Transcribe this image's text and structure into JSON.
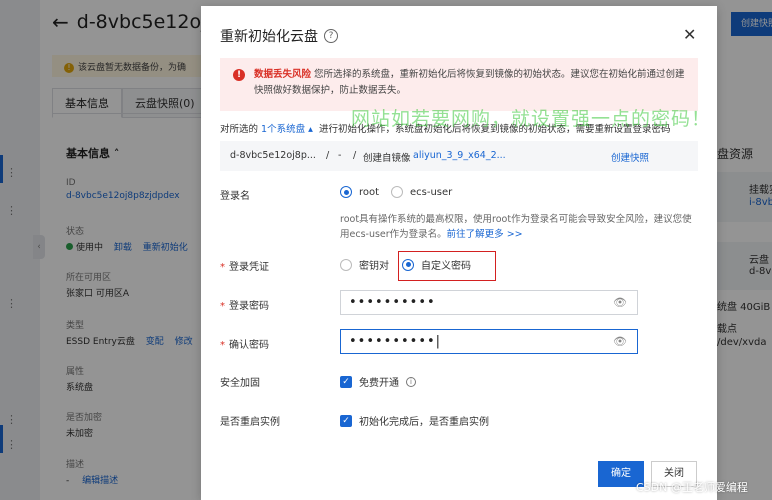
{
  "background": {
    "title": "d-8vbc5e12oj8",
    "notice": "该云盘暂无数据备份，为确",
    "tabs": [
      "基本信息",
      "云盘快照(0)"
    ],
    "section": "基本信息",
    "fields": [
      {
        "key": "ID",
        "value": "d-8vbc5e12oj8p8zjdpdex"
      },
      {
        "key": "状态",
        "value": "使用中",
        "link1": "卸载",
        "link2": "重新初始化"
      },
      {
        "key": "所在可用区",
        "value": "张家口 可用区A"
      },
      {
        "key": "类型",
        "value": "ESSD Entry云盘",
        "link1": "变配",
        "link2": "修改"
      },
      {
        "key": "属性",
        "value": "系统盘"
      },
      {
        "key": "是否加密",
        "value": "未加密"
      },
      {
        "key": "描述",
        "value": "-",
        "link1": "编辑描述"
      }
    ],
    "right": {
      "create_button": "创建快照",
      "res": "盘资源",
      "mount": "挂载实",
      "inst": "i-8vb",
      "cloud": "云盘",
      "disk": "d-8vb",
      "size": "统盘 40GiB",
      "mountpoint": "载点",
      "dev": "/dev/xvda"
    }
  },
  "dialog": {
    "title": "重新初始化云盘",
    "warning_title": "数据丢失风险",
    "warning_text": "您所选择的系统盘，重新初始化后将恢复到镜像的初始状态。建议您在初始化前通过创建快照做好数据保护，防止数据丢失。",
    "selection_prefix": "对所选的",
    "selection_link": "1个系统盘 ▴",
    "selection_suffix": "进行初始化操作，系统盘初始化后将恢复到镜像的初始状态，需要重新设置登录密码",
    "disk_id": "d-8vbc5e12oj8p...",
    "disk_slash": "/",
    "disk_dash": "-",
    "disk_slash2": "/",
    "disk_created_from": "创建自镜像",
    "disk_image": "aliyun_3_9_x64_2...",
    "create_snapshot": "创建快照",
    "login_name_label": "登录名",
    "login_root": "root",
    "login_ecs_user": "ecs-user",
    "login_hint": "root具有操作系统的最高权限，使用root作为登录名可能会导致安全风险，建议您使用ecs-user作为登录名。",
    "login_hint_link": "前往了解更多 >>",
    "credential_label": "登录凭证",
    "credential_keypair": "密钥对",
    "credential_custom": "自定义密码",
    "password_label": "登录密码",
    "password_value": "••••••••••",
    "confirm_label": "确认密码",
    "confirm_value": "••••••••••|",
    "hardening_label": "安全加固",
    "hardening_option": "免费开通",
    "restart_label": "是否重启实例",
    "restart_option": "初始化完成后，是否重启实例",
    "ok_button": "确定",
    "cancel_button": "关闭",
    "watermark": "网站如若要网购，就设置强一点的密码！"
  },
  "csdn_mark": "CSDN @王老师爱编程"
}
